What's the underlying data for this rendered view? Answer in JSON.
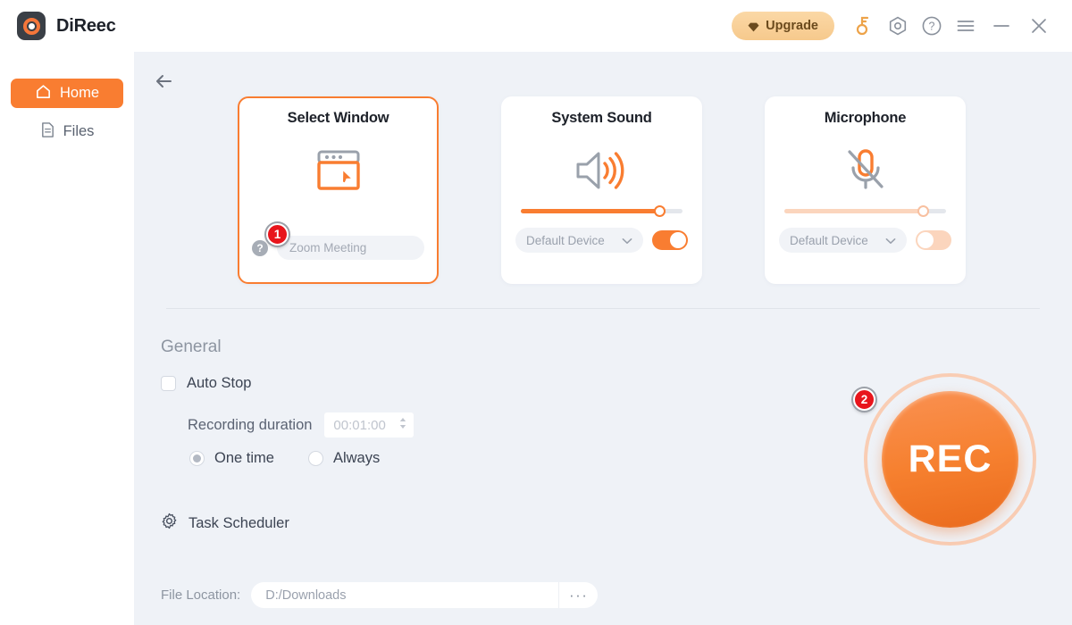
{
  "app": {
    "name": "DiReec",
    "logo_icon": "record-ring-logo"
  },
  "titlebar": {
    "upgrade_label": "Upgrade",
    "upgrade_icon": "diamond-icon",
    "icons": [
      {
        "name": "key-icon",
        "color": "#eda34a"
      },
      {
        "name": "hexagon-settings-icon",
        "color": "#8a919c"
      },
      {
        "name": "help-circle-icon",
        "color": "#8a919c"
      },
      {
        "name": "hamburger-menu-icon",
        "color": "#8a919c"
      }
    ],
    "minimize_icon": "minimize-icon",
    "close_icon": "close-icon"
  },
  "sidebar": {
    "items": [
      {
        "label": "Home",
        "icon": "home-icon",
        "active": true
      },
      {
        "label": "Files",
        "icon": "file-icon",
        "active": false
      }
    ]
  },
  "content": {
    "back_icon": "arrow-left-icon"
  },
  "cards": {
    "select_window": {
      "title": "Select Window",
      "icon": "window-cursor-icon",
      "selected": true,
      "help_icon": "question-mark-icon",
      "window_value": "",
      "window_placeholder": "Zoom Meeting",
      "badge": "1"
    },
    "system_sound": {
      "title": "System Sound",
      "icon": "speaker-on-icon",
      "volume_percent": 86,
      "device_label": "Default Device",
      "dropdown_icon": "chevron-down-icon",
      "toggle_state": "on"
    },
    "microphone": {
      "title": "Microphone",
      "icon": "microphone-muted-icon",
      "volume_percent": 86,
      "device_label": "Default Device",
      "dropdown_icon": "chevron-down-icon",
      "toggle_state": "off"
    }
  },
  "general": {
    "section_title": "General",
    "auto_stop_label": "Auto Stop",
    "auto_stop_checked": false,
    "recording_duration_label": "Recording duration",
    "recording_duration_value": "00:01:00",
    "stepper_icon": "up-down-arrows-icon",
    "radio_one_time": "One time",
    "radio_always": "Always",
    "radio_selected": "One time",
    "task_scheduler_label": "Task Scheduler",
    "task_scheduler_icon": "gear-icon"
  },
  "file_location": {
    "label": "File Location:",
    "value": "",
    "placeholder": "D:/Downloads",
    "browse_label": "···"
  },
  "record": {
    "label": "REC",
    "badge": "2"
  },
  "colors": {
    "accent": "#f97d31",
    "accent_dark": "#ea6a1c",
    "accent_light": "#fbd5bd",
    "badge_red": "#e8151c",
    "content_bg": "#eff2f7",
    "text_dark": "#1d2129",
    "text_muted": "#8d95a1"
  }
}
